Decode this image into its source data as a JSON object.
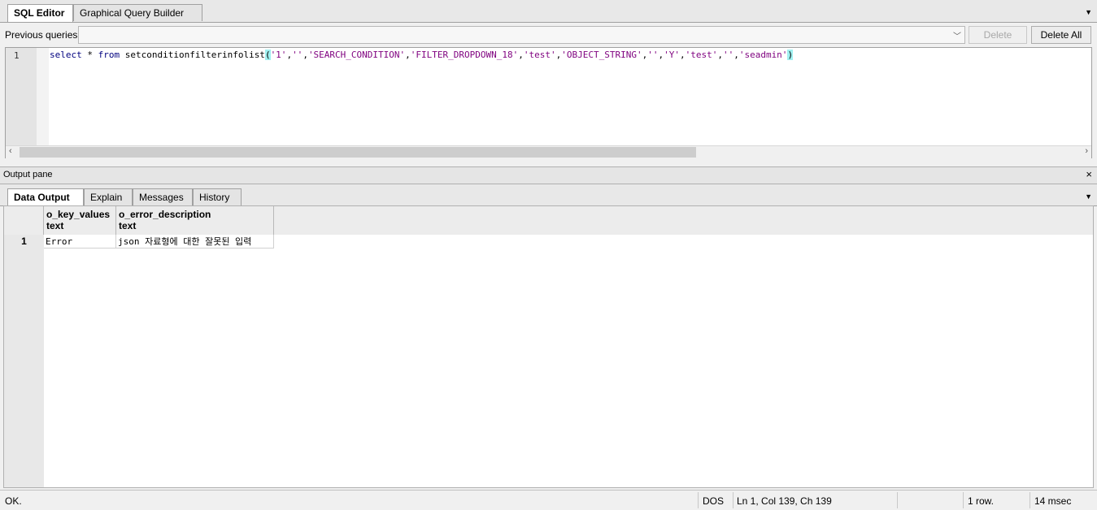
{
  "top_tabs": [
    {
      "label": "SQL Editor",
      "active": true
    },
    {
      "label": "Graphical Query Builder",
      "active": false
    }
  ],
  "previous_queries": {
    "label": "Previous queries",
    "selected": "",
    "delete_label": "Delete",
    "delete_all_label": "Delete All"
  },
  "editor": {
    "line_number": "1",
    "sql": {
      "kw_select": "select",
      "star": " * ",
      "kw_from": "from",
      "func": " setconditionfilterinfolist",
      "open": "(",
      "args": [
        {
          "type": "str",
          "text": "'1'"
        },
        {
          "type": "p",
          "text": ","
        },
        {
          "type": "str",
          "text": "''"
        },
        {
          "type": "p",
          "text": ","
        },
        {
          "type": "str",
          "text": "'SEARCH_CONDITION'"
        },
        {
          "type": "p",
          "text": ","
        },
        {
          "type": "str",
          "text": "'FILTER_DROPDOWN_18'"
        },
        {
          "type": "p",
          "text": ","
        },
        {
          "type": "str",
          "text": "'test'"
        },
        {
          "type": "p",
          "text": ","
        },
        {
          "type": "str",
          "text": "'OBJECT_STRING'"
        },
        {
          "type": "p",
          "text": ","
        },
        {
          "type": "str",
          "text": "''"
        },
        {
          "type": "p",
          "text": ","
        },
        {
          "type": "str",
          "text": "'Y'"
        },
        {
          "type": "p",
          "text": ","
        },
        {
          "type": "str",
          "text": "'test'"
        },
        {
          "type": "p",
          "text": ","
        },
        {
          "type": "str",
          "text": "''"
        },
        {
          "type": "p",
          "text": ","
        },
        {
          "type": "str",
          "text": "'seadmin'"
        }
      ],
      "close": ")"
    }
  },
  "output_pane": {
    "title": "Output pane",
    "close_icon": "×",
    "tabs": [
      {
        "label": "Data Output",
        "active": true
      },
      {
        "label": "Explain",
        "active": false
      },
      {
        "label": "Messages",
        "active": false
      },
      {
        "label": "History",
        "active": false
      }
    ],
    "columns": [
      {
        "name": "o_key_values",
        "type": "text"
      },
      {
        "name": "o_error_description",
        "type": "text"
      }
    ],
    "rows": [
      {
        "num": "1",
        "cells": [
          "Error",
          "json 자료형에 대한 잘못된 입력"
        ]
      }
    ]
  },
  "status_bar": {
    "message": "OK.",
    "encoding": "DOS",
    "position": "Ln 1, Col 139, Ch 139",
    "rows": "1 row.",
    "time": "14 msec"
  },
  "icons": {
    "menu": "menu-arrow-icon",
    "dropdown": "chevron-down-icon",
    "scroll_left": "arrow-left-icon",
    "scroll_right": "arrow-right-icon",
    "close": "close-icon"
  },
  "colors": {
    "keyword": "#00007f",
    "string": "#7f007f",
    "bracket_highlight": "#9ff0f0"
  }
}
